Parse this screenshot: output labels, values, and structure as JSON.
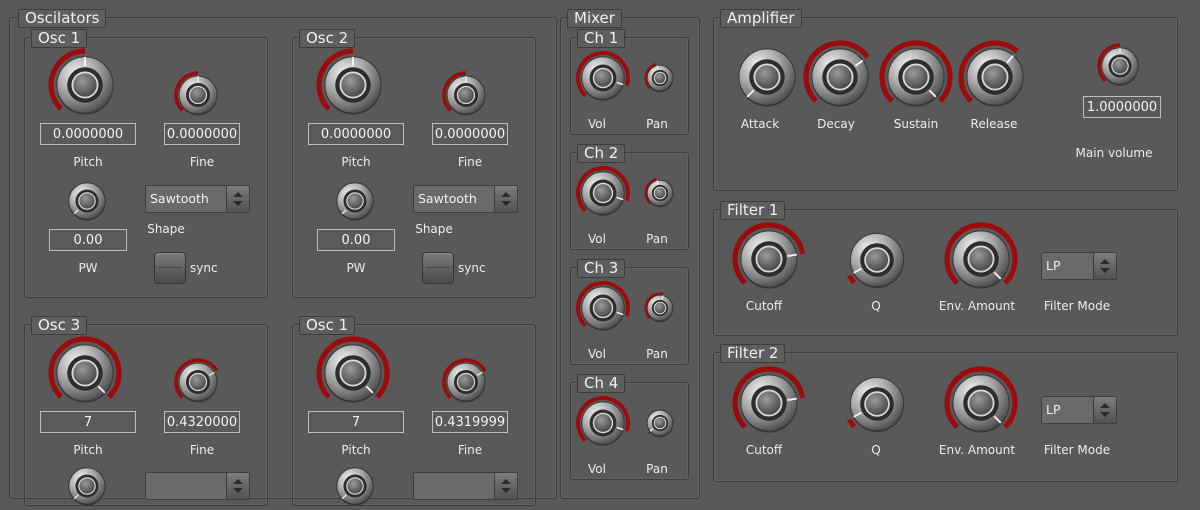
{
  "colors": {
    "arc": "#9b0b0b",
    "knob_hi": "#f0f0f0",
    "knob_lo": "#5a5a5a"
  },
  "oscillators": {
    "title": "Oscilators",
    "osc_a": {
      "title": "Osc 1",
      "pitch_value": "0.0000000",
      "pitch_label": "Pitch",
      "fine_value": "0.0000000",
      "fine_label": "Fine",
      "pw_value": "0.00",
      "pw_label": "PW",
      "shape_label": "Shape",
      "shape_value": "Sawtooth",
      "sync_label": "sync"
    },
    "osc_b": {
      "title": "Osc 2",
      "pitch_value": "0.0000000",
      "pitch_label": "Pitch",
      "fine_value": "0.0000000",
      "fine_label": "Fine",
      "pw_value": "0.00",
      "pw_label": "PW",
      "shape_label": "Shape",
      "shape_value": "Sawtooth",
      "sync_label": "sync"
    },
    "osc_c": {
      "title": "Osc 3",
      "pitch_value": "7",
      "pitch_label": "Pitch",
      "fine_value": "0.4320000",
      "fine_label": "Fine"
    },
    "osc_d": {
      "title": "Osc 1",
      "pitch_value": "7",
      "pitch_label": "Pitch",
      "fine_value": "0.4319999",
      "fine_label": "Fine"
    }
  },
  "mixer": {
    "title": "Mixer",
    "channels": [
      {
        "title": "Ch 1",
        "vol_label": "Vol",
        "pan_label": "Pan"
      },
      {
        "title": "Ch 2",
        "vol_label": "Vol",
        "pan_label": "Pan"
      },
      {
        "title": "Ch 3",
        "vol_label": "Vol",
        "pan_label": "Pan"
      },
      {
        "title": "Ch 4",
        "vol_label": "Vol",
        "pan_label": "Pan"
      }
    ]
  },
  "amplifier": {
    "title": "Amplifier",
    "attack_label": "Attack",
    "decay_label": "Decay",
    "sustain_label": "Sustain",
    "release_label": "Release",
    "main_volume_value": "1.0000000",
    "main_volume_label": "Main volume"
  },
  "filter1": {
    "title": "Filter 1",
    "cutoff_label": "Cutoff",
    "q_label": "Q",
    "env_label": "Env. Amount",
    "mode_label": "Filter Mode",
    "mode_value": "LP"
  },
  "filter2": {
    "title": "Filter 2",
    "cutoff_label": "Cutoff",
    "q_label": "Q",
    "env_label": "Env. Amount",
    "mode_label": "Filter Mode",
    "mode_value": "LP"
  }
}
